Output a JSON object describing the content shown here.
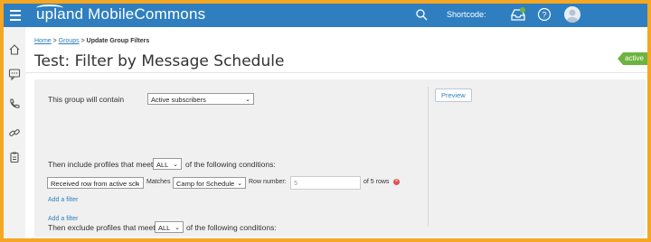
{
  "topbar": {
    "brand": "upland MobileCommons",
    "shortcode_label": "Shortcode:"
  },
  "icons": {
    "menu": "hamburger-icon",
    "search": "search-icon",
    "inbox": "inbox-icon",
    "help": "help-icon",
    "avatar": "avatar",
    "sidenav": [
      "home-icon",
      "chat-icon",
      "phone-icon",
      "link-icon",
      "clipboard-icon"
    ],
    "remove": "remove-icon"
  },
  "breadcrumb": {
    "home": "Home",
    "sep1": ">",
    "groups": "Groups",
    "sep2": ">",
    "current": "Update Group Filters"
  },
  "page": {
    "title": "Test: Filter by Message Schedule",
    "status": "active"
  },
  "filter": {
    "contain_label": "This group will contain",
    "contain_value": "Active subscribers",
    "include_prefix": "Then include profiles that meet",
    "include_match_value": "ALL",
    "include_suffix": "of the following conditions:",
    "condition": {
      "field_value": "Received row from active sch",
      "matches_label": "Matches",
      "schedule_value": "Camp for Schedule",
      "row_label": "Row number:",
      "row_value": "5",
      "rows_suffix": "of 5 rows"
    },
    "add_filter_1": "Add a filter",
    "exclude_prefix": "Then exclude profiles that meet",
    "exclude_match_value": "ALL",
    "exclude_suffix": "of the following conditions:",
    "add_filter_2": "Add a filter"
  },
  "actions": {
    "preview_label": "Preview"
  },
  "colors": {
    "topbar": "#2f7fc0",
    "frame": "#f5a623",
    "status": "#6db33f",
    "link": "#2f7fc0"
  }
}
